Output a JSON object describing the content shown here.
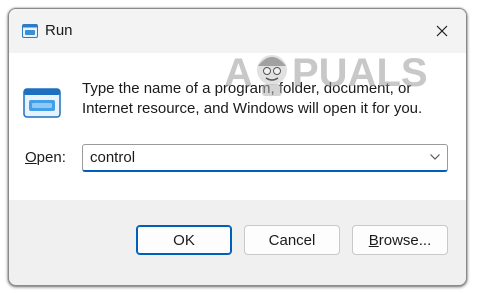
{
  "window": {
    "title": "Run",
    "close_glyph": "✕",
    "icons": [
      "run-app-icon",
      "close-icon"
    ]
  },
  "content": {
    "icon": "run-app-icon",
    "description_line1": "Type the name of a program, folder, document, or",
    "description_line2": "Internet resource, and Windows will open it for you."
  },
  "open_field": {
    "label_accel": "O",
    "label_rest": "pen:",
    "value": "control"
  },
  "buttons": {
    "ok": "OK",
    "cancel": "Cancel",
    "browse_accel": "B",
    "browse_rest": "rowse..."
  },
  "watermark": {
    "text_left": "A",
    "text_right": "PUALS"
  },
  "colors": {
    "accent": "#005fb8",
    "icon_blue": "#3a8fd6",
    "window_bg": "#f0f0f0"
  }
}
